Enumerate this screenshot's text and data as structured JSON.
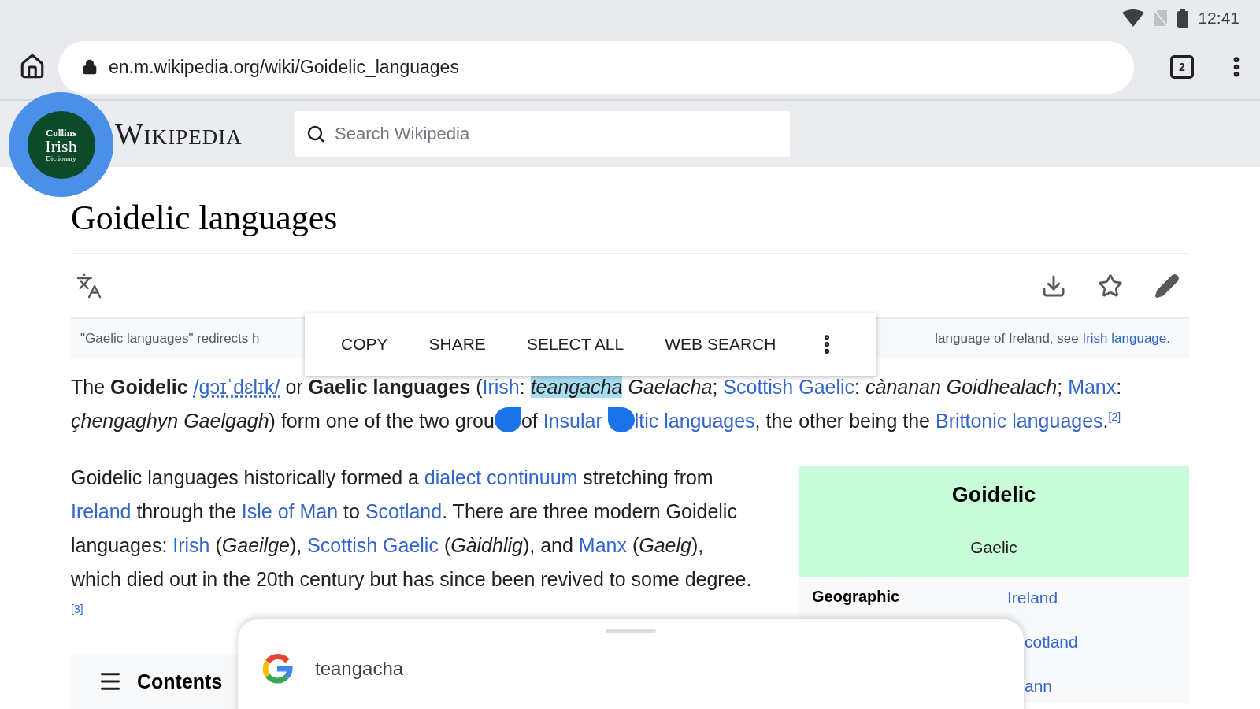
{
  "status_bar": {
    "time": "12:41"
  },
  "browser": {
    "url": "en.m.wikipedia.org/wiki/Goidelic_languages",
    "tab_count": "2"
  },
  "wiki_header": {
    "logo": "Wikipedia",
    "search": {
      "placeholder": "Search Wikipedia"
    }
  },
  "dictionary_bubble": {
    "lines": [
      "Collins",
      "Irish",
      "Dictionary"
    ]
  },
  "article": {
    "title": "Goidelic languages",
    "hatnote": {
      "left": "\"Gaelic languages\" redirects h",
      "right": "language of Ireland, see ",
      "link": "Irish language",
      "end": "."
    },
    "paragraphs": [
      [
        {
          "kind": "plain",
          "text": "The **Goidelic** "
        },
        {
          "kind": "ipa",
          "text": "/ɡɔɪˈdɛlɪk/"
        },
        {
          "kind": "plain",
          "text": " or **Gaelic languages** ("
        },
        {
          "kind": "link",
          "text": "Irish"
        },
        {
          "kind": "plain",
          "text": ": "
        },
        {
          "kind": "selected",
          "text": "teangacha"
        },
        {
          "kind": "plain",
          "text": " *Gaelacha*; "
        },
        {
          "kind": "link",
          "text": "Scottish Gaelic"
        },
        {
          "kind": "plain",
          "text": ": *cànanan Goidhealach*; "
        },
        {
          "kind": "link",
          "text": "Manx"
        },
        {
          "kind": "plain",
          "text": ": *çhengaghyn Gaelgagh*) form one of the two grou"
        },
        {
          "kind": "handle_left"
        },
        {
          "kind": "plain",
          "text": "of "
        },
        {
          "kind": "link",
          "text": "Insular"
        },
        {
          "kind": "handle_right"
        },
        {
          "kind": "link",
          "text": "ltic languages"
        },
        {
          "kind": "plain",
          "text": ", the other being the "
        },
        {
          "kind": "link",
          "text": "Brittonic languages"
        },
        {
          "kind": "plain",
          "text": "."
        },
        {
          "kind": "ref",
          "text": "[2]"
        }
      ],
      [
        {
          "kind": "plain",
          "text": "Goidelic languages historically formed a "
        },
        {
          "kind": "link",
          "text": "dialect continuum"
        },
        {
          "kind": "plain",
          "text": " stretching from "
        },
        {
          "kind": "link",
          "text": "Ireland"
        },
        {
          "kind": "plain",
          "text": " through the "
        },
        {
          "kind": "link",
          "text": "Isle of Man"
        },
        {
          "kind": "plain",
          "text": " to "
        },
        {
          "kind": "link",
          "text": "Scotland"
        },
        {
          "kind": "plain",
          "text": ". There are three modern Goidelic languages: "
        },
        {
          "kind": "link",
          "text": "Irish"
        },
        {
          "kind": "plain",
          "text": " (*Gaeilge*), "
        },
        {
          "kind": "link",
          "text": "Scottish Gaelic"
        },
        {
          "kind": "plain",
          "text": " (*Gàidhlig*), and "
        },
        {
          "kind": "link",
          "text": "Manx"
        },
        {
          "kind": "plain",
          "text": " (*Gaelg*), which died out in the 20th century but has since been revived to some degree."
        },
        {
          "kind": "ref",
          "text": "[3]"
        }
      ]
    ],
    "contents": "Contents"
  },
  "infobox": {
    "title": "Goidelic",
    "subtitle": "Gaelic",
    "rows": [
      {
        "label": "Geographic",
        "values": [
          {
            "text": "Ireland",
            "partial": false
          },
          {
            "text": "cotland",
            "partial": true
          },
          {
            "text": "ann",
            "partial": true
          }
        ]
      }
    ]
  },
  "context_menu": {
    "items": [
      "COPY",
      "SHARE",
      "SELECT ALL",
      "WEB SEARCH"
    ]
  },
  "search_sheet": {
    "query": "teangacha"
  }
}
